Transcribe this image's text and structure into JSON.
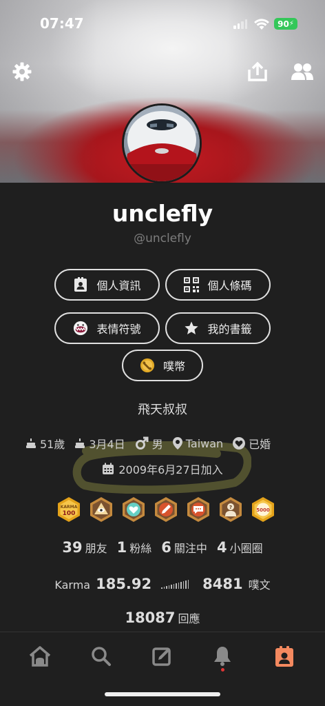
{
  "status_bar": {
    "time": "07:47",
    "battery": "90"
  },
  "cover": {
    "settings_icon": "gear-icon",
    "share_icon": "share-icon",
    "friends_icon": "people-icon"
  },
  "profile": {
    "display_name": "unclefly",
    "handle": "@unclefly",
    "nickname": "飛天叔叔"
  },
  "buttons": {
    "profile_info": "個人資訊",
    "qr_code": "個人條碼",
    "emoticons": "表情符號",
    "bookmarks": "我的書籤",
    "coins": "噗幣"
  },
  "info": {
    "age": "51歲",
    "birthday": "3月4日",
    "gender": "男",
    "location": "Taiwan",
    "relationship": "已婚",
    "joined": "2009年6月27日加入"
  },
  "badges": [
    {
      "name": "karma-100-badge",
      "text": "KARMA\n100",
      "color": "#e3a21a"
    },
    {
      "name": "eye-pyramid-badge",
      "color": "#b87a3a"
    },
    {
      "name": "heart-badge",
      "color": "#9a6a3a"
    },
    {
      "name": "pencil-badge",
      "color": "#a8503a"
    },
    {
      "name": "speech-badge",
      "color": "#a8503a"
    },
    {
      "name": "profile-question-badge",
      "color": "#8a6a4a"
    },
    {
      "name": "plurks-5000-badge",
      "text": "5000",
      "color": "#e3a21a"
    }
  ],
  "stats": {
    "friends_count": "39",
    "friends_label": "朋友",
    "fans_count": "1",
    "fans_label": "粉絲",
    "following_count": "6",
    "following_label": "關注中",
    "cliques_count": "4",
    "cliques_label": "小圈圈"
  },
  "karma": {
    "label": "Karma",
    "value": "185.92",
    "plurks_count": "8481",
    "plurks_label": "噗文"
  },
  "replies": {
    "count": "18087",
    "label": "回應"
  },
  "tabbar": {
    "items": [
      "home-icon",
      "search-icon",
      "compose-icon",
      "bell-icon",
      "profile-icon"
    ],
    "active_color": "#f4895f"
  }
}
